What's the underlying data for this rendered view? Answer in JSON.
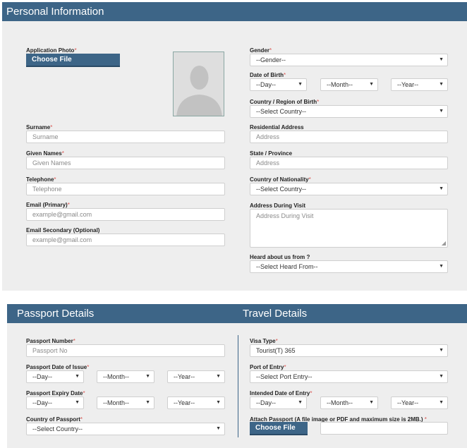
{
  "personal": {
    "header": "Personal Information",
    "photo_label": "Application Photo",
    "choose_file": "Choose File",
    "surname_label": "Surname",
    "surname_placeholder": "Surname",
    "given_label": "Given Names",
    "given_placeholder": "Given Names",
    "telephone_label": "Telephone",
    "telephone_placeholder": "Telephone",
    "email_label": "Email (Primary)",
    "email_placeholder": "example@gmail.com",
    "email2_label": "Email Secondary (Optional)",
    "email2_placeholder": "example@gmail.com",
    "gender_label": "Gender",
    "gender_value": "--Gender--",
    "dob_label": "Date of Birth",
    "day_value": "--Day--",
    "month_value": "--Month--",
    "year_value": "--Year--",
    "birth_country_label": "Country / Region of Birth",
    "select_country": "--Select Country--",
    "address_label": "Residential Address",
    "address_placeholder": "Address",
    "state_label": "State / Province",
    "state_placeholder": "Address",
    "nationality_label": "Country of Nationality",
    "visit_address_label": "Address During Visit",
    "visit_address_placeholder": "Address During Visit",
    "heard_label": "Heard about us from ?",
    "heard_value": "--Select Heard From--"
  },
  "passport": {
    "header": "Passport Details",
    "number_label": "Passport Number",
    "number_placeholder": "Passport No",
    "issue_label": "Passport Date of Issue",
    "expiry_label": "Passport Expiry Date",
    "country_label": "Country of Passport",
    "select_country": "--Select Country--",
    "day_value": "--Day--",
    "month_value": "--Month--",
    "year_value": "--Year--"
  },
  "travel": {
    "header": "Travel Details",
    "visa_label": "Visa Type",
    "visa_value": "Tourist(T) 365",
    "port_label": "Port of Entry",
    "port_value": "--Select Port Entry--",
    "entry_date_label": "Intended Date of Entry",
    "attach_label": "Attach Passport (A file image or PDF and maximum size is 2MB.)",
    "choose_file": "Choose File",
    "day_value": "--Day--",
    "month_value": "--Month--",
    "year_value": "--Year--"
  },
  "common": {
    "required_mark": "*",
    "arrow": "▼",
    "grip": "◢"
  },
  "colors": {
    "header_bg": "#3d6587",
    "panel_bg": "#eeeeee",
    "required": "#d9534f"
  }
}
